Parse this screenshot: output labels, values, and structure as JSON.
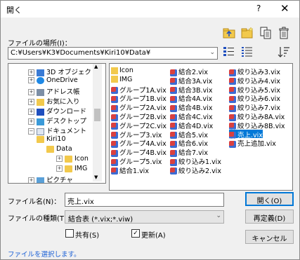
{
  "window": {
    "title": "開く",
    "help_glyph": "?",
    "close_glyph": "✕"
  },
  "location": {
    "label": "ファイルの場所(I)：",
    "path": "C:¥Users¥K3¥Documents¥Kiri10¥Data¥"
  },
  "toolbar_icons": [
    "folder-up-icon",
    "new-folder-icon",
    "copy-icon",
    "trash-icon",
    "large-icons-view-icon",
    "list-view-icon",
    "sort-icon"
  ],
  "tree": {
    "items": [
      {
        "label": "3D オブジェクト",
        "icon": "3d-objects-icon"
      },
      {
        "label": "OneDrive",
        "icon": "onedrive-icon"
      },
      {
        "label": "アドレス帳",
        "icon": "address-book-icon"
      },
      {
        "label": "お気に入り",
        "icon": "favorites-icon"
      },
      {
        "label": "ダウンロード",
        "icon": "download-icon"
      },
      {
        "label": "デスクトップ",
        "icon": "desktop-icon"
      },
      {
        "label": "ドキュメント",
        "icon": "documents-icon"
      },
      {
        "label": "Kiri10",
        "icon": "folder-icon"
      },
      {
        "label": "Data",
        "icon": "folder-open-icon"
      },
      {
        "label": "Icon",
        "icon": "folder-icon"
      },
      {
        "label": "IMG",
        "icon": "folder-icon"
      },
      {
        "label": "ピクチャ",
        "icon": "pictures-icon"
      }
    ]
  },
  "files": [
    {
      "name": "Icon",
      "type": "folder"
    },
    {
      "name": "IMG",
      "type": "folder"
    },
    {
      "name": "グループ1A.vix",
      "type": "vix"
    },
    {
      "name": "グループ1B.vix",
      "type": "vix"
    },
    {
      "name": "グループ2A.vix",
      "type": "vix"
    },
    {
      "name": "グループ2B.vix",
      "type": "vix"
    },
    {
      "name": "グループ2C.vix",
      "type": "vix"
    },
    {
      "name": "グループ3.vix",
      "type": "vix"
    },
    {
      "name": "グループ4A.vix",
      "type": "vix"
    },
    {
      "name": "グループ4B.vix",
      "type": "vix"
    },
    {
      "name": "グループ5.vix",
      "type": "vix"
    },
    {
      "name": "結合1.vix",
      "type": "vix"
    },
    {
      "name": "結合2.vix",
      "type": "vix"
    },
    {
      "name": "結合3A.vix",
      "type": "vix"
    },
    {
      "name": "結合3B.vix",
      "type": "vix"
    },
    {
      "name": "結合4A.vix",
      "type": "vix"
    },
    {
      "name": "結合4B.vix",
      "type": "vix"
    },
    {
      "name": "結合4C.vix",
      "type": "vix"
    },
    {
      "name": "結合4D.vix",
      "type": "vix"
    },
    {
      "name": "結合5.vix",
      "type": "vix"
    },
    {
      "name": "結合6.vix",
      "type": "vix"
    },
    {
      "name": "結合7.vix",
      "type": "vix"
    },
    {
      "name": "絞り込み1.vix",
      "type": "vix"
    },
    {
      "name": "絞り込み2.vix",
      "type": "vix"
    },
    {
      "name": "絞り込み3.vix",
      "type": "vix"
    },
    {
      "name": "絞り込み4.vix",
      "type": "vix"
    },
    {
      "name": "絞り込み5.vix",
      "type": "vix"
    },
    {
      "name": "絞り込み6.vix",
      "type": "vix"
    },
    {
      "name": "絞り込み7.vix",
      "type": "vix"
    },
    {
      "name": "絞り込み8A.vix",
      "type": "vix"
    },
    {
      "name": "絞り込み8B.vix",
      "type": "vix"
    },
    {
      "name": "売上.vix",
      "type": "vix",
      "selected": true
    },
    {
      "name": "売上追加.vix",
      "type": "vix"
    }
  ],
  "filename": {
    "label": "ファイル名(N)：",
    "value": "売上.vix"
  },
  "filetype": {
    "label": "ファイルの種類(T)：",
    "value": "結合表 (*.vix;*.viw)"
  },
  "checkboxes": {
    "shared": {
      "label": "共有(S)",
      "checked": false
    },
    "update": {
      "label": "更新(A)",
      "checked": true
    }
  },
  "buttons": {
    "open": "開く(O)",
    "refresh": "再定義(D)",
    "cancel": "キャンセル"
  },
  "status": "ファイルを選択します。",
  "colors": {
    "selection": "#0078d7",
    "status_text": "#1a5fd6",
    "folder": "#f2c94c"
  }
}
